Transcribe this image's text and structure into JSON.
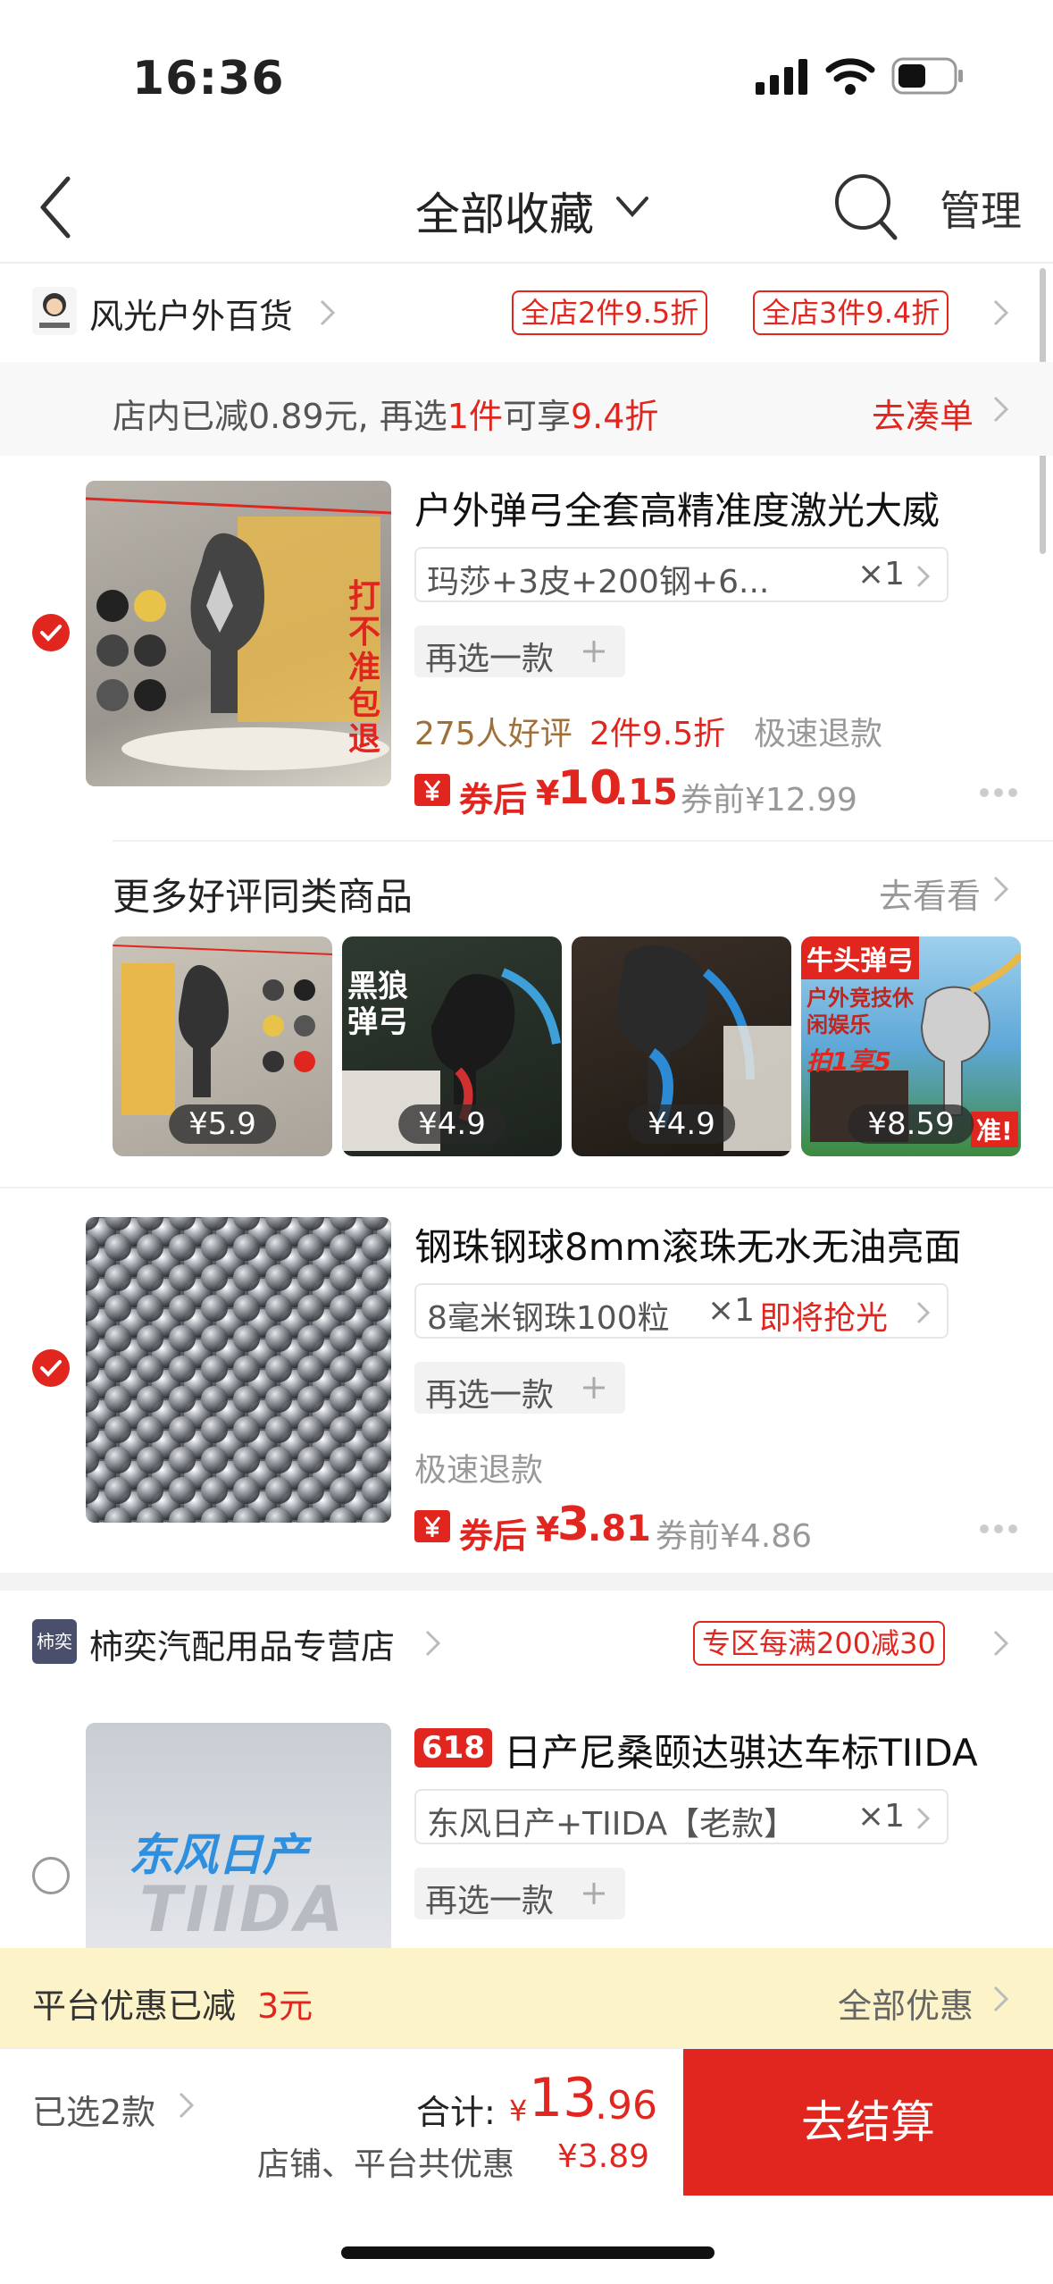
{
  "status": {
    "time": "16:36"
  },
  "nav": {
    "title": "全部收藏",
    "manage": "管理"
  },
  "stores": [
    {
      "name": "风光户外百货",
      "promos": [
        "全店2件9.5折",
        "全店3件9.4折"
      ],
      "reduction": {
        "prefix": "店内已减0.89元, 再选",
        "count": "1件",
        "middle": "可享",
        "discount": "9.4折",
        "link": "去凑单"
      },
      "product": {
        "title": "户外弹弓全套高精准度激光大威",
        "sku": "玛莎+3皮+200钢+6...",
        "qty": "×1",
        "again": "再选一款",
        "reviews": "275人好评",
        "deal": "2件9.5折",
        "fast_refund": "极速退款",
        "coupon_label": "券后",
        "price_symbol": "¥",
        "price_int": "10",
        "price_dec": ".15",
        "before": "券前¥12.99"
      }
    }
  ],
  "recommend": {
    "title": "更多好评同类商品",
    "link": "去看看",
    "items": [
      {
        "price": "¥5.9"
      },
      {
        "price": "¥4.9"
      },
      {
        "price": "¥4.9"
      },
      {
        "price": "¥8.59"
      }
    ]
  },
  "product2": {
    "title": "钢珠钢球8mm滚珠无水无油亮面",
    "sku": "8毫米钢珠100粒",
    "qty": "×1",
    "urgent": "即将抢光",
    "again": "再选一款",
    "fast_refund": "极速退款",
    "coupon_label": "券后",
    "price_symbol": "¥",
    "price_int": "3",
    "price_dec": ".81",
    "before": "券前¥4.86"
  },
  "store2": {
    "logo": "柿奕",
    "name": "柿奕汽配用品专营店",
    "promo": "专区每满200减30",
    "product": {
      "badge": "618",
      "title": "日产尼桑颐达骐达车标TIIDA",
      "sku": "东风日产+TIIDA【老款】",
      "qty": "×1",
      "again": "再选一款",
      "img_text_top": "东风日产",
      "img_text_bottom": "TIIDA"
    }
  },
  "image_text": {
    "p1_side": "打不准包退",
    "r2_top": "黑狼弹弓",
    "r4_top": "牛头弹弓",
    "r4_sub": "户外竞技休闲娱乐",
    "r4_promo": "拍1享5",
    "r4_corner": "准!"
  },
  "platform": {
    "label": "平台优惠已减",
    "amount": "3元",
    "link": "全部优惠"
  },
  "footer": {
    "selected": "已选2款",
    "total_label": "合计:",
    "total_symbol": "¥",
    "total_int": "13",
    "total_dec": ".96",
    "discount_label": "店铺、平台共优惠",
    "discount_amount": "¥3.89",
    "checkout": "去结算"
  },
  "colors": {
    "accent": "#e0261f",
    "promo_bg": "#fdf3c8"
  }
}
